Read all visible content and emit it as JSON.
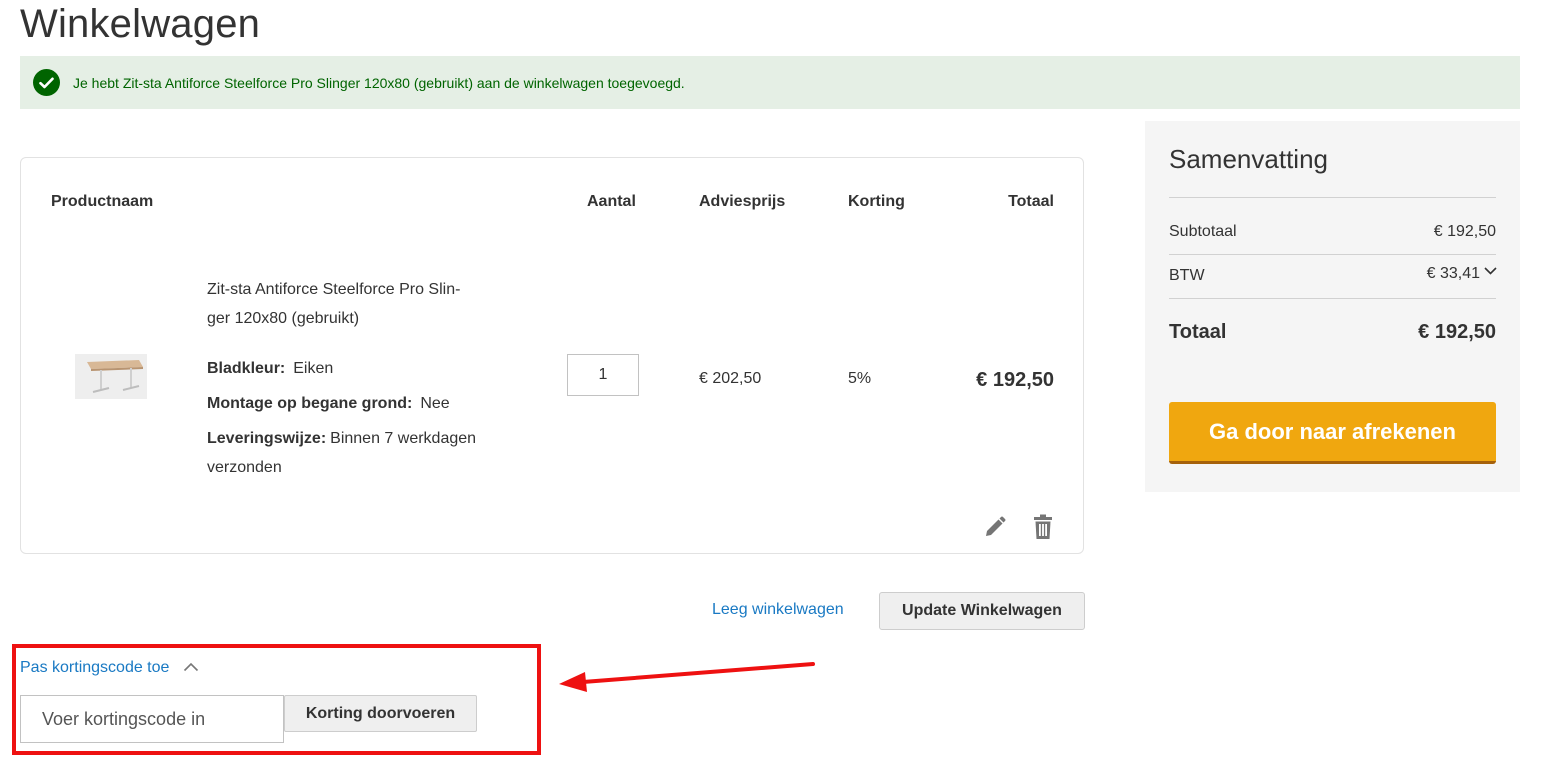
{
  "page": {
    "title": "Winkelwagen"
  },
  "message": {
    "text": "Je hebt Zit-sta Antiforce Steelforce Pro Slinger 120x80 (gebruikt) aan de winkelwagen toegevoegd.",
    "icon": "check-circle-icon",
    "color": "#006400"
  },
  "cart": {
    "headers": {
      "product": "Productnaam",
      "qty": "Aantal",
      "price": "Adviesprijs",
      "discount": "Korting",
      "total": "Totaal"
    },
    "item": {
      "name_line1": "Zit-sta Antiforce Steelforce Pro Slin-",
      "name_line2": "ger 120x80 (gebruikt)",
      "options": [
        {
          "label": "Bladkleur:",
          "value": "Eiken"
        },
        {
          "label": "Montage op begane grond:",
          "value": "Nee"
        },
        {
          "label": "Leveringswijze:",
          "value": "Binnen 7 werkdagen verzonden"
        }
      ],
      "qty": "1",
      "price": "€ 202,50",
      "discount": "5%",
      "total": "€ 192,50"
    },
    "actions": {
      "empty": "Leeg winkelwagen",
      "update": "Update Winkelwagen"
    }
  },
  "summary": {
    "title": "Samenvatting",
    "subtotal_label": "Subtotaal",
    "subtotal_value": "€ 192,50",
    "tax_label": "BTW",
    "tax_value": "€ 33,41",
    "total_label": "Totaal",
    "total_value": "€ 192,50",
    "checkout": "Ga door naar afrekenen",
    "accent": "#f0a70f"
  },
  "discount": {
    "toggle": "Pas kortingscode toe",
    "placeholder": "Voer kortingscode in",
    "apply": "Korting doorvoeren"
  },
  "annotation": {
    "color": "#ee1111"
  }
}
